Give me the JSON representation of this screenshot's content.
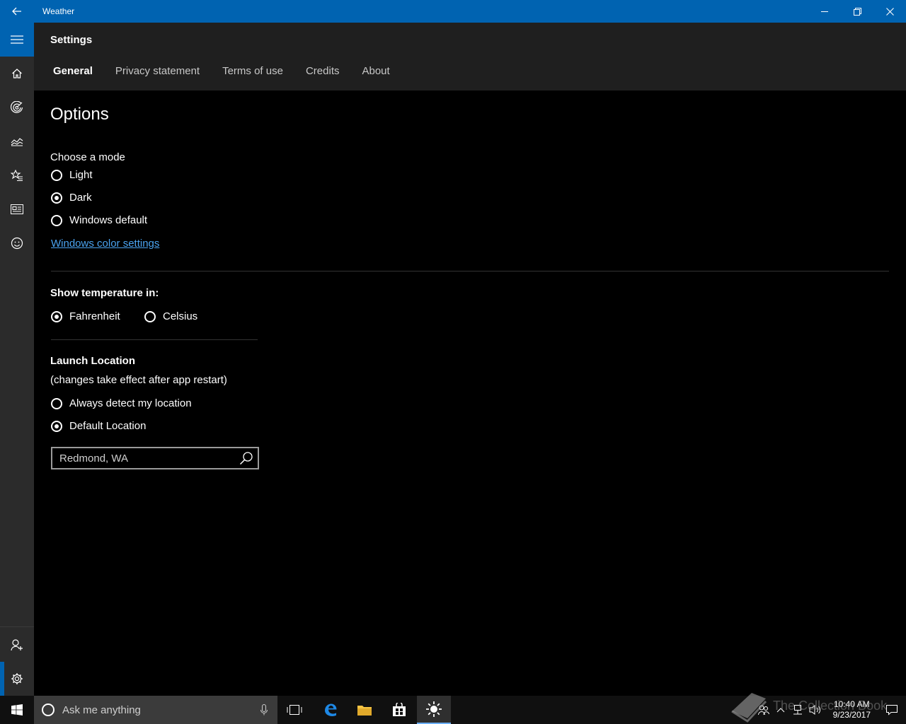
{
  "window": {
    "title": "Weather"
  },
  "header": {
    "title": "Settings",
    "tabs": [
      {
        "label": "General",
        "active": true
      },
      {
        "label": "Privacy statement",
        "active": false
      },
      {
        "label": "Terms of use",
        "active": false
      },
      {
        "label": "Credits",
        "active": false
      },
      {
        "label": "About",
        "active": false
      }
    ]
  },
  "options": {
    "heading": "Options",
    "mode_label": "Choose a mode",
    "modes": [
      {
        "label": "Light",
        "selected": false
      },
      {
        "label": "Dark",
        "selected": true
      },
      {
        "label": "Windows default",
        "selected": false
      }
    ],
    "color_link": "Windows color settings",
    "temp_label": "Show temperature in:",
    "temps": [
      {
        "label": "Fahrenheit",
        "selected": true
      },
      {
        "label": "Celsius",
        "selected": false
      }
    ],
    "launch_label": "Launch Location",
    "launch_note": "(changes take effect after app restart)",
    "launch_options": [
      {
        "label": "Always detect my location",
        "selected": false
      },
      {
        "label": "Default Location",
        "selected": true
      }
    ],
    "location_value": "Redmond, WA"
  },
  "taskbar": {
    "search_placeholder": "Ask me anything",
    "time": "10:40 AM",
    "date": "9/23/2017"
  },
  "watermark": "The Collection Book",
  "colors": {
    "accent": "#0063b1",
    "link": "#4aa3f0"
  }
}
